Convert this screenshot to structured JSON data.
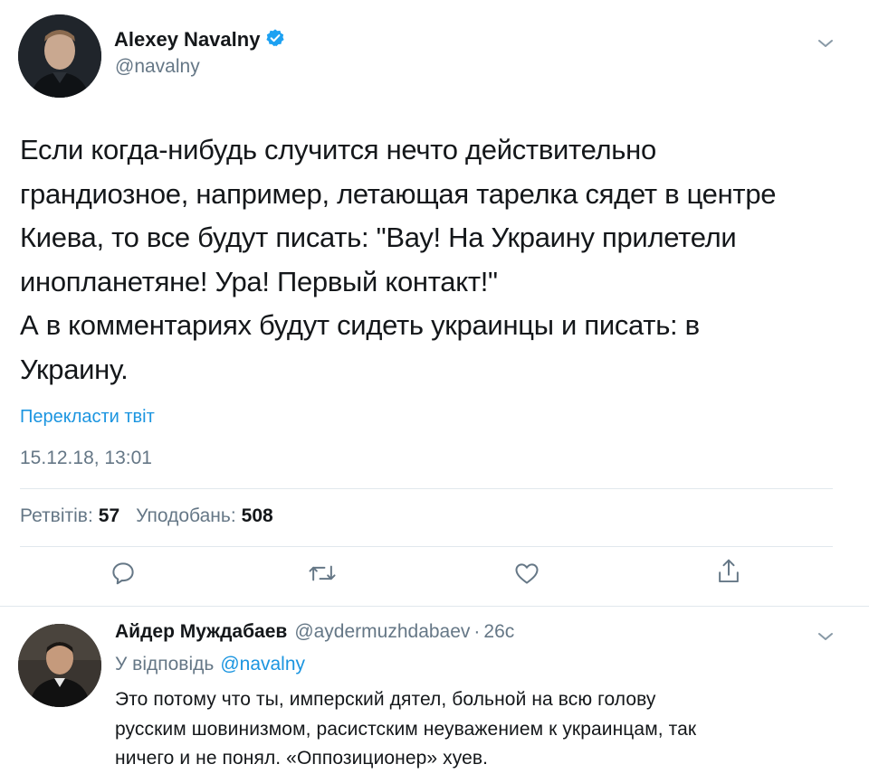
{
  "tweet": {
    "author_name": "Alexey Navalny",
    "author_handle": "@navalny",
    "text": "Если когда-нибудь случится нечто действительно\nграндиозное, например, летающая тарелка сядет в центре\nКиева, то все будут писать: \"Вау! На Украину прилетели\nинопланетяне! Ура! Первый контакт!\"\nА в комментариях будут сидеть украинцы и писать: в\nУкраину.",
    "translate_label": "Перекласти твіт",
    "timestamp": "15.12.18, 13:01",
    "retweets_label": "Ретвітів:",
    "retweets_count": "57",
    "likes_label": "Уподобань:",
    "likes_count": "508"
  },
  "reply": {
    "author_name": "Айдер Муждабаев",
    "author_handle": "@aydermuzhdabaev",
    "separator": "·",
    "age": "26с",
    "replying_to_label": "У відповідь",
    "replying_to_handle": "@navalny",
    "text": "Это потому что ты, имперский дятел, больной на всю голову\nрусским шовинизмом, расистским неуважением к украинцам, так\nничего и не понял. «Оппозиционер» хуев."
  },
  "icons": {
    "verified": "verified-badge-icon",
    "menu": "chevron-down-icon",
    "reply": "reply-icon",
    "retweet": "retweet-icon",
    "like": "heart-icon",
    "share": "share-icon"
  },
  "colors": {
    "link": "#1b95e0",
    "secondary_text": "#657786",
    "divider": "#e1e8ed",
    "verified": "#1da1f2"
  }
}
